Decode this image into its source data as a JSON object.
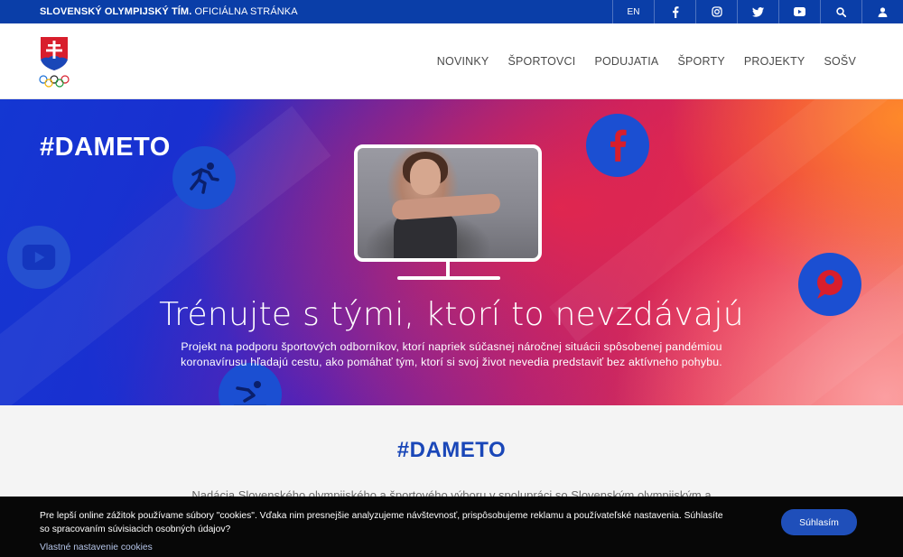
{
  "topbar": {
    "title_bold": "SLOVENSKÝ OLYMPIJSKÝ TÍM.",
    "title_sub": "OFICIÁLNA STRÁNKA",
    "language": "EN",
    "icons": [
      "facebook-icon",
      "instagram-icon",
      "twitter-icon",
      "youtube-icon",
      "search-icon",
      "user-icon"
    ]
  },
  "nav": {
    "items": [
      {
        "label": "NOVINKY"
      },
      {
        "label": "ŠPORTOVCI"
      },
      {
        "label": "PODUJATIA"
      },
      {
        "label": "ŠPORTY"
      },
      {
        "label": "PROJEKTY"
      },
      {
        "label": "SOŠV"
      }
    ]
  },
  "hero": {
    "tag": "#DAMETO",
    "title": "Trénujte s tými, ktorí to nevzdávajú",
    "description": "Projekt na podporu športových odborníkov, ktorí napriek súčasnej náročnej situácii spôsobenej pandémiou koronavírusu hľadajú cestu, ako pomáhať tým, ktorí si svoj život nevedia predstaviť bez aktívneho pohybu.",
    "bubbles": [
      "running-icon",
      "facebook-icon",
      "youtube-icon",
      "chat-icon",
      "swimming-icon"
    ]
  },
  "content": {
    "heading": "#DAMETO",
    "text": "Nadácia Slovenského olympijského a športového výboru v spolupráci so Slovenským olympijským a"
  },
  "cookie": {
    "message": "Pre lepší online zážitok používame súbory \"cookies\". Vďaka nim presnejšie analyzujeme návštevnosť, prispôsobujeme reklamu a používateľské nastavenia. Súhlasíte so spracovaním súvisiacich osobných údajov?",
    "settings_link": "Vlastné nastavenie cookies",
    "agree_label": "Súhlasím"
  },
  "colors": {
    "brand_blue": "#0a3ea8",
    "heading_blue": "#1a47b8",
    "button_blue": "#1f4fba"
  }
}
